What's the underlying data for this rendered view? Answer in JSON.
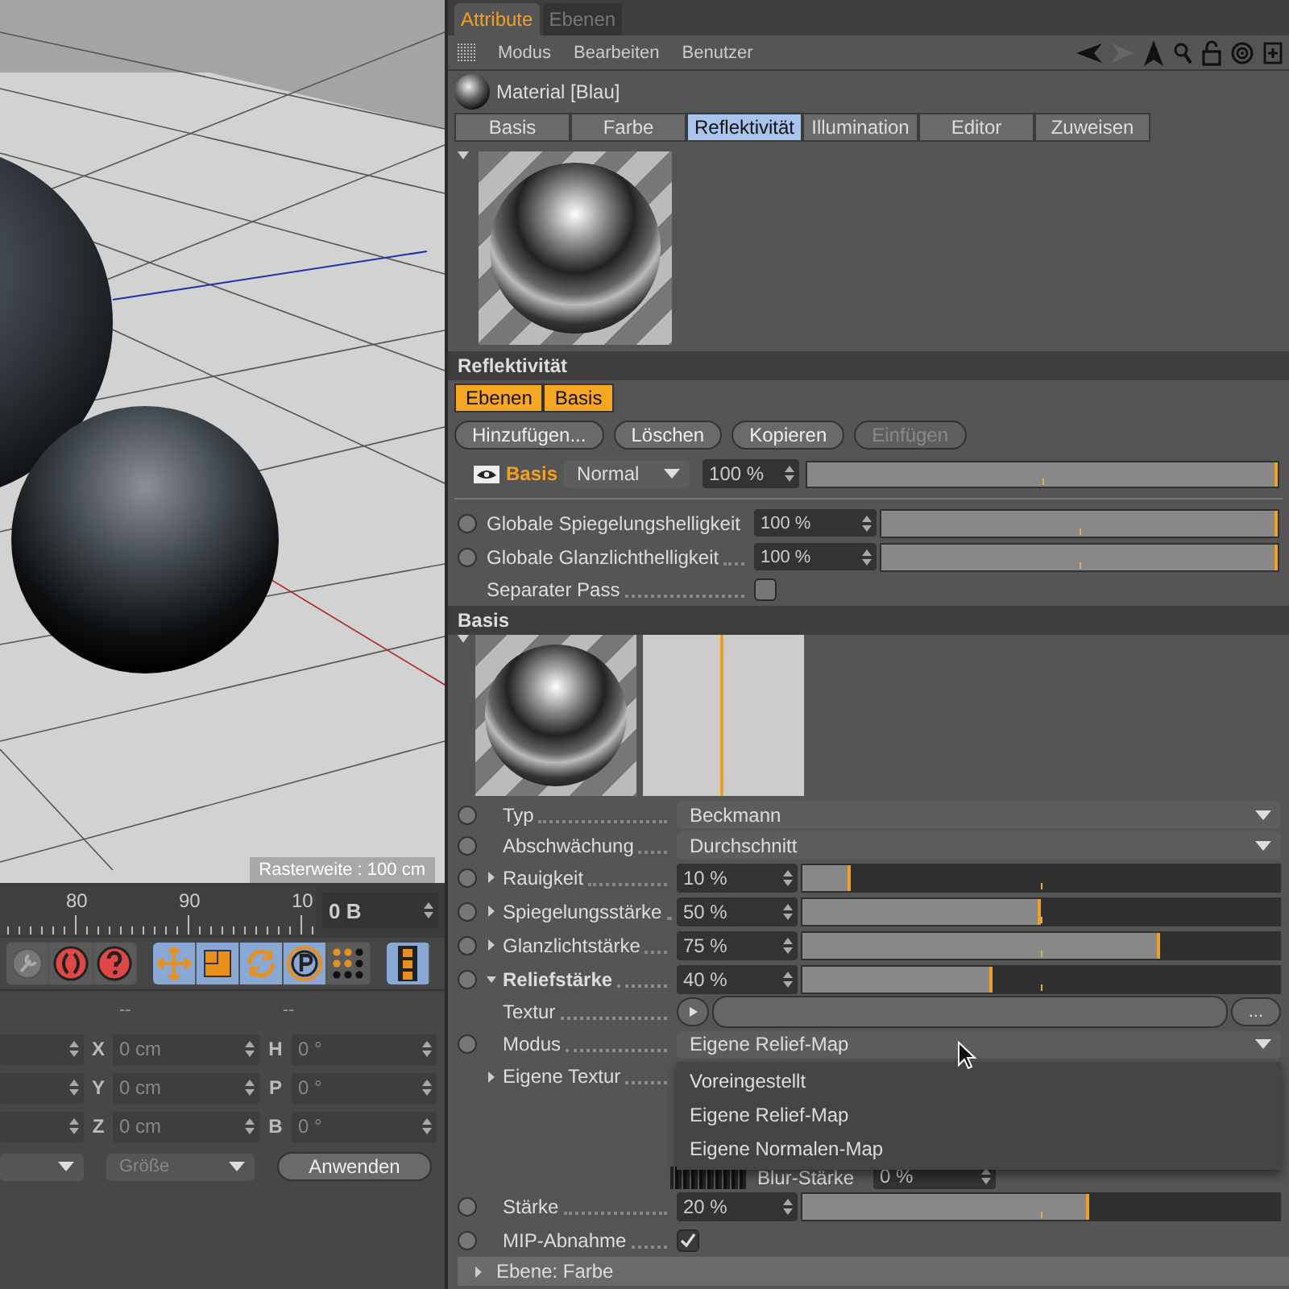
{
  "viewport": {
    "grid_label": "Rasterweite : 100 cm"
  },
  "timeline": {
    "ticks": [
      "80",
      "90",
      "10"
    ],
    "frame_field": "0 B"
  },
  "coordinates": {
    "headers": [
      "--",
      "--"
    ],
    "rows": [
      {
        "axis": "X",
        "position": "0 cm",
        "rot_axis": "H",
        "rotation": "0 °"
      },
      {
        "axis": "Y",
        "position": "0 cm",
        "rot_axis": "P",
        "rotation": "0 °"
      },
      {
        "axis": "Z",
        "position": "0 cm",
        "rot_axis": "B",
        "rotation": "0 °"
      }
    ],
    "size_mode": "Größe",
    "apply_button": "Anwenden"
  },
  "attributes": {
    "manager_tabs": [
      {
        "label": "Attribute",
        "selected": true
      },
      {
        "label": "Ebenen",
        "selected": false
      }
    ],
    "menu": [
      "Modus",
      "Bearbeiten",
      "Benutzer"
    ],
    "object_title": "Material [Blau]",
    "tabs": [
      {
        "label": "Basis",
        "selected": false
      },
      {
        "label": "Farbe",
        "selected": false
      },
      {
        "label": "Reflektivität",
        "selected": true
      },
      {
        "label": "Illumination",
        "selected": false
      },
      {
        "label": "Editor",
        "selected": false
      },
      {
        "label": "Zuweisen",
        "selected": false
      }
    ],
    "reflectance": {
      "title": "Reflektivität",
      "layer_tabs": [
        {
          "label": "Ebenen",
          "selected": true
        },
        {
          "label": "Basis",
          "selected": true
        }
      ],
      "buttons": [
        {
          "label": "Hinzufügen...",
          "disabled": false
        },
        {
          "label": "Löschen",
          "disabled": false
        },
        {
          "label": "Kopieren",
          "disabled": false
        },
        {
          "label": "Einfügen",
          "disabled": true
        }
      ],
      "layer": {
        "name": "Basis",
        "visible": true,
        "blend": "Normal",
        "opacity": "100 %",
        "level": 1
      },
      "globals": [
        {
          "label": "Globale Spiegelungshelligkeit",
          "value": "100 %",
          "level": 1
        },
        {
          "label": "Globale Glanzlichthelligkeit",
          "value": "100 %",
          "level": 1
        }
      ],
      "separate_pass": {
        "label": "Separater Pass",
        "checked": false
      }
    },
    "basis": {
      "title": "Basis",
      "params": [
        {
          "kind": "dropdown",
          "anim": true,
          "label": "Typ",
          "value": "Beckmann"
        },
        {
          "kind": "dropdown",
          "anim": true,
          "label": "Abschwächung",
          "value": "Durchschnitt"
        },
        {
          "kind": "slider",
          "anim": true,
          "expanded": false,
          "label": "Rauigkeit",
          "value": "10 %",
          "level": 0.1
        },
        {
          "kind": "slider",
          "anim": true,
          "expanded": false,
          "label": "Spiegelungsstärke",
          "value": "50 %",
          "level": 0.5
        },
        {
          "kind": "slider",
          "anim": true,
          "expanded": false,
          "label": "Glanzlichtstärke",
          "value": "75 %",
          "level": 0.75
        },
        {
          "kind": "slider",
          "anim": true,
          "expanded": true,
          "label": "Reliefstärke",
          "value": "40 %",
          "level": 0.4
        },
        {
          "kind": "texture",
          "anim": false,
          "label": "Textur",
          "button": "..."
        },
        {
          "kind": "dropdown",
          "anim": true,
          "label": "Modus",
          "value": "Eigene Relief-Map",
          "open": true,
          "options": [
            "Voreingestellt",
            "Eigene Relief-Map",
            "Eigene Normalen-Map"
          ]
        },
        {
          "kind": "group",
          "anim": false,
          "expanded": false,
          "label": "Eigene Textur"
        },
        {
          "kind": "blur",
          "label": "Blur-Stärke",
          "value": "0 %"
        },
        {
          "kind": "slider",
          "anim": true,
          "label": "Stärke",
          "value": "20 %",
          "level": 0.6
        },
        {
          "kind": "checkbox",
          "anim": true,
          "label": "MIP-Abnahme",
          "checked": true
        }
      ]
    },
    "collapsed_group": {
      "label": "Ebene: Farbe",
      "expanded": false
    }
  }
}
